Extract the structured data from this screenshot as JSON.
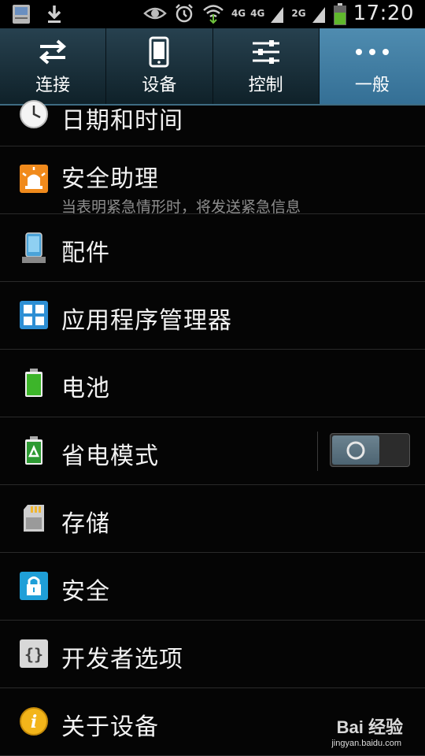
{
  "status_bar": {
    "left_icons": [
      "app-notification-icon",
      "download-icon"
    ],
    "right_icons": [
      "eye-icon",
      "alarm-icon",
      "wifi-icon",
      "signal-4g-icon",
      "signal-2g-icon",
      "battery-icon"
    ],
    "net_1": "4G",
    "net_2": "4G",
    "net_3": "2G",
    "time": "17:20"
  },
  "tabs": [
    {
      "label": "连接",
      "icon": "swap-arrows-icon",
      "active": false
    },
    {
      "label": "设备",
      "icon": "phone-icon",
      "active": false
    },
    {
      "label": "控制",
      "icon": "sliders-icon",
      "active": false
    },
    {
      "label": "一般",
      "icon": "more-dots-icon",
      "active": true
    }
  ],
  "items": [
    {
      "title": "日期和时间",
      "icon": "clock-icon"
    },
    {
      "title": "安全助理",
      "subtitle": "当表明紧急情形时，将发送紧急信息",
      "icon": "emergency-light-icon"
    },
    {
      "title": "配件",
      "icon": "dock-phone-icon"
    },
    {
      "title": "应用程序管理器",
      "icon": "apps-grid-icon"
    },
    {
      "title": "电池",
      "icon": "battery-full-icon"
    },
    {
      "title": "省电模式",
      "icon": "battery-recycle-icon",
      "toggle": "off"
    },
    {
      "title": "存储",
      "icon": "sd-card-icon"
    },
    {
      "title": "安全",
      "icon": "lock-icon"
    },
    {
      "title": "开发者选项",
      "icon": "braces-icon"
    },
    {
      "title": "关于设备",
      "icon": "info-icon"
    }
  ],
  "watermark": {
    "top": "Bai  经验",
    "bottom": "jingyan.baidu.com"
  },
  "colors": {
    "tab_bar": "#1b3340",
    "tab_active": "#3f7ea4",
    "background": "#050505",
    "text": "#f2f2f2",
    "subtext": "#8e8e8e"
  }
}
